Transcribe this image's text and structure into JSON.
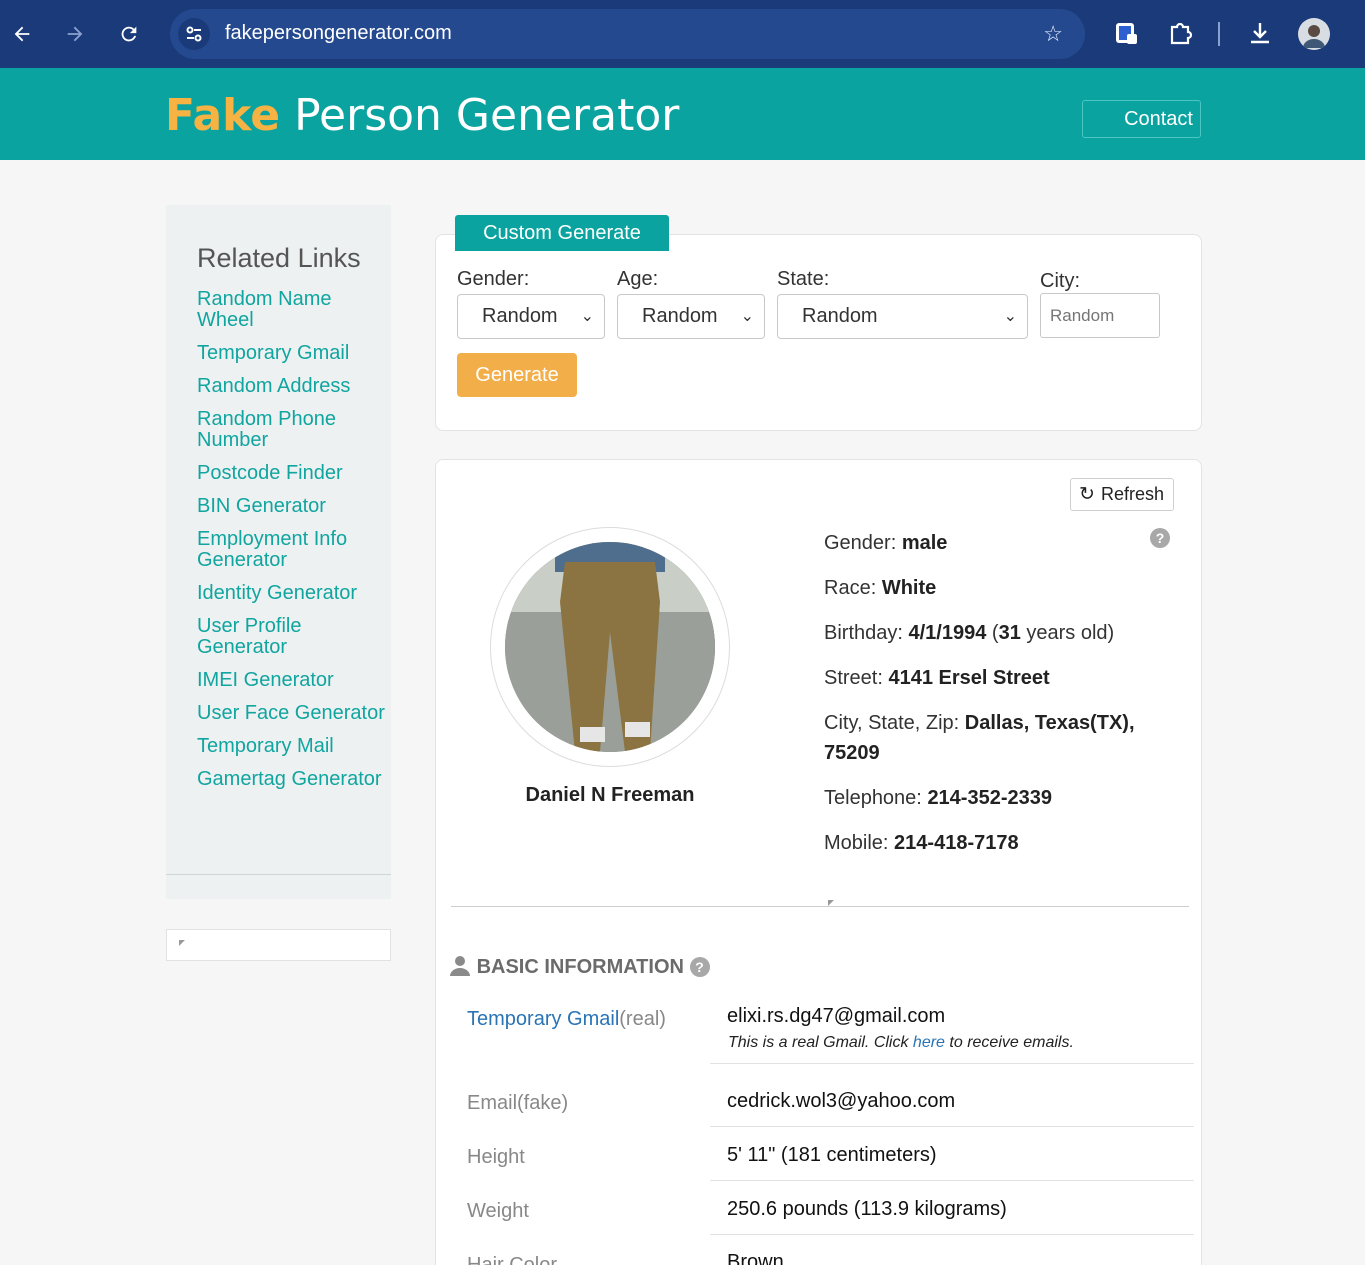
{
  "browser": {
    "url": "fakepersongenerator.com"
  },
  "header": {
    "logo_fake": "Fake",
    "logo_rest": " Person Generator",
    "contact": "Contact"
  },
  "sidebar": {
    "title": "Related Links",
    "links": [
      "Random Name Wheel",
      "Temporary Gmail",
      "Random Address",
      "Random Phone Number",
      "Postcode Finder",
      "BIN Generator",
      "Employment Info Generator",
      "Identity Generator",
      "User Profile Generator",
      "IMEI Generator",
      "User Face Generator",
      "Temporary Mail",
      "Gamertag Generator"
    ]
  },
  "generator": {
    "tab": "Custom Generate",
    "gender_label": "Gender:",
    "gender_value": "Random",
    "age_label": "Age:",
    "age_value": "Random",
    "state_label": "State:",
    "state_value": "Random",
    "city_label": "City:",
    "city_placeholder": "Random",
    "generate": "Generate"
  },
  "person": {
    "refresh": "Refresh",
    "name": "Daniel N Freeman",
    "gender_key": "Gender:",
    "gender": "male",
    "race_key": "Race:",
    "race": "White",
    "birthday_key": "Birthday:",
    "birthday": "4/1/1994",
    "age": "31",
    "age_suffix": " years old)",
    "street_key": "Street:",
    "street": "4141 Ersel Street",
    "csz_key": "City, State, Zip:",
    "csz": "Dallas, Texas(TX), 75209",
    "telephone_key": "Telephone:",
    "telephone": "214-352-2339",
    "mobile_key": "Mobile:",
    "mobile": "214-418-7178"
  },
  "basic_info": {
    "title": "BASIC INFORMATION",
    "gmail_link": "Temporary Gmail",
    "gmail_suffix": "(real)",
    "gmail": "elixi.rs.dg47@gmail.com",
    "gmail_note_pre": "This is a real Gmail. Click ",
    "gmail_note_here": "here",
    "gmail_note_post": " to receive emails.",
    "email_key": "Email(fake)",
    "email": "cedrick.wol3@yahoo.com",
    "height_key": "Height",
    "height": "5' 11\" (181 centimeters)",
    "weight_key": "Weight",
    "weight": "250.6 pounds (113.9 kilograms)",
    "hair_key": "Hair Color",
    "hair": "Brown"
  }
}
